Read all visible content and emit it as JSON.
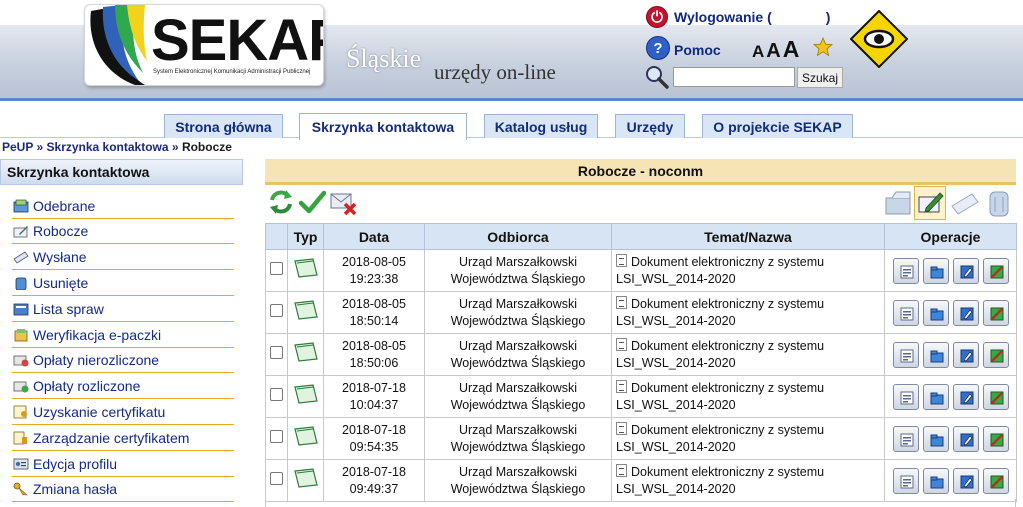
{
  "header": {
    "logo_text": "SEKAP",
    "logo_subtitle": "System Elektronicznej Komunikacji Administracji Publicznej",
    "tagline_1": "Śląskie",
    "tagline_2": "urzędy on-line",
    "logout_label": "Wylogowanie",
    "logout_paren_open": "(",
    "logout_paren_close": ")",
    "help_label": "Pomoc",
    "font_sizes": [
      "A",
      "A",
      "A"
    ],
    "search_placeholder": "",
    "search_button": "Szukaj",
    "colors": {
      "band": "#c7d0de",
      "link": "#102880",
      "accent_line": "#5a88c8"
    }
  },
  "tabs": [
    {
      "label": "Strona główna",
      "active": false
    },
    {
      "label": "Skrzynka kontaktowa",
      "active": true
    },
    {
      "label": "Katalog usług",
      "active": false
    },
    {
      "label": "Urzędy",
      "active": false
    },
    {
      "label": "O projekcie SEKAP",
      "active": false
    }
  ],
  "breadcrumb": {
    "items": [
      "PeUP",
      "Skrzynka kontaktowa",
      "Robocze"
    ],
    "separator": "»"
  },
  "sidebar": {
    "title": "Skrzynka kontaktowa",
    "items": [
      {
        "label": "Odebrane",
        "icon": "inbox-icon"
      },
      {
        "label": "Robocze",
        "icon": "draft-icon"
      },
      {
        "label": "Wysłane",
        "icon": "sent-icon"
      },
      {
        "label": "Usunięte",
        "icon": "trash-icon"
      },
      {
        "label": "Lista spraw",
        "icon": "case-list-icon"
      },
      {
        "label": "Weryfikacja e-paczki",
        "icon": "package-icon"
      },
      {
        "label": "Opłaty nierozliczone",
        "icon": "payment-icon"
      },
      {
        "label": "Opłaty rozliczone",
        "icon": "payment-done-icon"
      },
      {
        "label": "Uzyskanie certyfikatu",
        "icon": "certificate-icon"
      },
      {
        "label": "Zarządzanie certyfikatem",
        "icon": "certificate-manage-icon"
      },
      {
        "label": "Edycja profilu",
        "icon": "profile-icon"
      },
      {
        "label": "Zmiana hasła",
        "icon": "key-icon"
      }
    ]
  },
  "main": {
    "title": "Robocze - noconm",
    "columns": [
      "Typ",
      "Data",
      "Odbiorca",
      "Temat/Nazwa",
      "Operacje"
    ],
    "rows": [
      {
        "date": "2018-08-05",
        "time": "19:23:38",
        "recipient_1": "Urząd Marszałkowski",
        "recipient_2": "Województwa Śląskiego",
        "topic_1": "Dokument elektroniczny z systemu",
        "topic_2": "LSI_WSL_2014-2020"
      },
      {
        "date": "2018-08-05",
        "time": "18:50:14",
        "recipient_1": "Urząd Marszałkowski",
        "recipient_2": "Województwa Śląskiego",
        "topic_1": "Dokument elektroniczny z systemu",
        "topic_2": "LSI_WSL_2014-2020"
      },
      {
        "date": "2018-08-05",
        "time": "18:50:06",
        "recipient_1": "Urząd Marszałkowski",
        "recipient_2": "Województwa Śląskiego",
        "topic_1": "Dokument elektroniczny z systemu",
        "topic_2": "LSI_WSL_2014-2020"
      },
      {
        "date": "2018-07-18",
        "time": "10:04:37",
        "recipient_1": "Urząd Marszałkowski",
        "recipient_2": "Województwa Śląskiego",
        "topic_1": "Dokument elektroniczny z systemu",
        "topic_2": "LSI_WSL_2014-2020"
      },
      {
        "date": "2018-07-18",
        "time": "09:54:35",
        "recipient_1": "Urząd Marszałkowski",
        "recipient_2": "Województwa Śląskiego",
        "topic_1": "Dokument elektroniczny z systemu",
        "topic_2": "LSI_WSL_2014-2020"
      },
      {
        "date": "2018-07-18",
        "time": "09:49:37",
        "recipient_1": "Urząd Marszałkowski",
        "recipient_2": "Województwa Śląskiego",
        "topic_1": "Dokument elektroniczny z systemu",
        "topic_2": "LSI_WSL_2014-2020"
      }
    ],
    "operations": [
      "details-icon",
      "folder-icon",
      "edit-icon",
      "delete-icon"
    ]
  }
}
